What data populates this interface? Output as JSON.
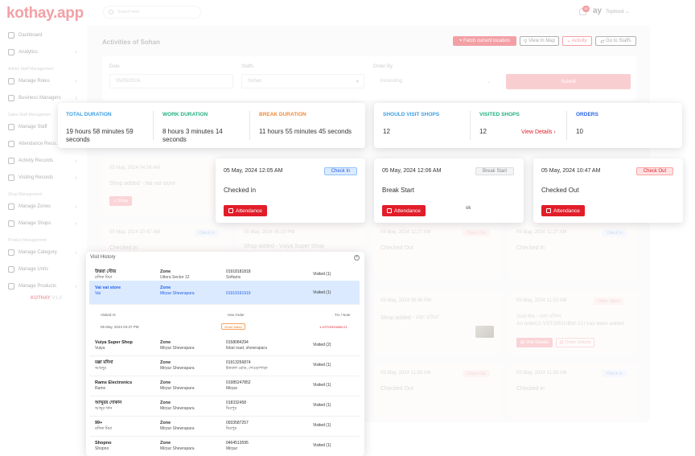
{
  "app": {
    "logo": "kothay.app",
    "version_brand": "KOTHAY",
    "version": "V1.0"
  },
  "sidebar": {
    "items": [
      {
        "label": "Dashboard"
      },
      {
        "label": "Analytics"
      },
      {
        "label": "Manage Roles"
      },
      {
        "label": "Business Managers"
      },
      {
        "label": "Manage Staff"
      },
      {
        "label": "Attendance Reco..."
      },
      {
        "label": "Activity Records"
      },
      {
        "label": "Visiting Records"
      },
      {
        "label": "Manage Zones"
      },
      {
        "label": "Manage Shops"
      },
      {
        "label": "Manage Category"
      },
      {
        "label": "Manage Units"
      },
      {
        "label": "Manage Products"
      }
    ],
    "sections": [
      "Admin Staff Management",
      "Sales Staff Managemen",
      "Shop Management",
      "Product Management"
    ]
  },
  "topbar": {
    "search_placeholder": "Search here",
    "notif_count": "10",
    "avatar_text": "ay",
    "user": "Topmost"
  },
  "page": {
    "title": "Activities of Sohan"
  },
  "actions": {
    "fetch": "Fetch current location",
    "map": "View In Map",
    "activity": "Activity",
    "staffs": "Go to Staffs"
  },
  "filters": {
    "date_label": "Date",
    "date_value": "05/05/2024",
    "staffs_label": "Staffs",
    "staffs_value": "Sohan",
    "order_label": "Order By",
    "order_value": "Ascending",
    "submit": "Submit"
  },
  "stats_left": {
    "total_label": "TOTAL DURATION",
    "total_value": "19 hours 58 minutes 59 seconds",
    "work_label": "WORK DURATION",
    "work_value": "8 hours 3 minutes 14 seconds",
    "break_label": "BREAK DURATION",
    "break_value": "11 hours 55 minutes 45 seconds",
    "colors": {
      "total": "#3b9de0",
      "work": "#22b07d",
      "break": "#f08a3c"
    }
  },
  "stats_right": {
    "should_label": "SHOULD VISIT SHOPS",
    "should_value": "12",
    "visited_label": "VISITED SHOPS",
    "visited_value": "12",
    "view_details": "View Details",
    "orders_label": "ORDERS",
    "orders_value": "10",
    "colors": {
      "should": "#3b9de0",
      "visited": "#22b07d",
      "orders": "#2563eb"
    }
  },
  "activity_cards": [
    {
      "date": "05 May, 2024 12:05 AM",
      "tag": "Check In",
      "text": "Checked in",
      "button": "Attendance"
    },
    {
      "date": "05 May, 2024 12:06 AM",
      "tag": "Break Start",
      "text": "Break Start",
      "button": "Attendance",
      "note": "ok"
    },
    {
      "date": "05 May, 2024 10:47 AM",
      "tag": "Check Out",
      "text": "Checked Out",
      "button": "Attendance"
    }
  ],
  "background_cards": {
    "c1_date": "05 May, 2024 04:56 AM",
    "c1_text": "Shop added - Vai vai store",
    "c1_btn": "Shop",
    "c2_date": "05 May, 2024 10:47 AM",
    "c2_tag": "Check In",
    "c2_text": "Checked in",
    "c3_date": "05 May, 2024 05:10 PM",
    "c3_text": "Shop added - Vuiya Super Shop",
    "c4_date": "05 May, 2024 11:27 AM",
    "c4_tag": "Check Out",
    "c4_text": "Checked Out",
    "c5_date": "05 May, 2024 11:27 AM",
    "c5_tag": "Check In",
    "c5_text": "Checked in",
    "c6_date": "05 May, 2024 05:45 PM",
    "c6_text": "Shop added - মক্কা মদিনা",
    "c7_date": "05 May, 2024 11:53 AM",
    "c7_tag": "Order Taken",
    "c7_text": "Visit the - মক্কা মদিনা",
    "c7_text2": "An order(1-VSTOR2UBW-21) has been added",
    "c7_btn1": "Visit Details",
    "c7_btn2": "Order Details",
    "c8_date": "05 May, 2024 11:58 AM",
    "c8_tag": "Check Out",
    "c8_text": "Checked Out",
    "c9_date": "05 May, 2024 11:58 AM",
    "c9_tag": "Check In",
    "c9_text": "Checked in"
  },
  "visit_history": {
    "title": "Visit History",
    "rows": [
      {
        "name": "উত্তরা স্টোর",
        "sub": "রফিক মিয়া",
        "zone": "Zone",
        "zone_sub": "Uttora Sector 12",
        "phone": "01918181818",
        "addr": "Softanis",
        "status": "Visited (1)"
      },
      {
        "name": "Vai vai store",
        "sub": "Vai",
        "zone": "Zone",
        "zone_sub": "Mirpur Shewrapara",
        "phone": "01919191919",
        "addr": "",
        "status": "Visited (1)"
      },
      {
        "name": "Vuiya Super Shop",
        "sub": "Vuiya",
        "zone": "Zone",
        "zone_sub": "Mirpur Shewrapara",
        "phone": "0158084294",
        "addr": "Ikbal road, shewrapara",
        "status": "Visited (2)"
      },
      {
        "name": "মক্কা মদিনা",
        "sub": "আবদুর",
        "zone": "Zone",
        "zone_sub": "Mirpur Shewrapara",
        "phone": "01913256874",
        "addr": "ইকবাল রোড, শেওড়াপাড়া",
        "status": "Visited (1)"
      },
      {
        "name": "Rams Electronics",
        "sub": "Rams",
        "zone": "Zone",
        "zone_sub": "Mirpur Shewrapara",
        "phone": "01985247852",
        "addr": "Mirpur",
        "status": "Visited (1)"
      },
      {
        "name": "আব্দুরর দোকান",
        "sub": "আব্দুর খান",
        "zone": "Zone",
        "zone_sub": "Mirpur Shewrapara",
        "phone": "018332458",
        "addr": "মিরপুর",
        "status": "Visited (1)"
      },
      {
        "name": "99+",
        "sub": "রফিক মিয়া",
        "zone": "Zone",
        "zone_sub": "Mirpur Shewrapara",
        "phone": "0933587257",
        "addr": "মিরপুর",
        "status": "Visited (1)"
      },
      {
        "name": "Shopno",
        "sub": "Shopno",
        "zone": "Zone",
        "zone_sub": "Mirpur Shewrapara",
        "phone": "0464513595",
        "addr": "Mirpur",
        "status": "Visited (1)"
      }
    ],
    "sub_header": {
      "visited_at": "Visited At",
      "has_order": "Has Order",
      "trx": "Trx / Note",
      "time": "05 May, 2024 03:37 PM",
      "order_tag": "Order Taken",
      "order_id": "1-VSTOR2UBW-21"
    }
  }
}
